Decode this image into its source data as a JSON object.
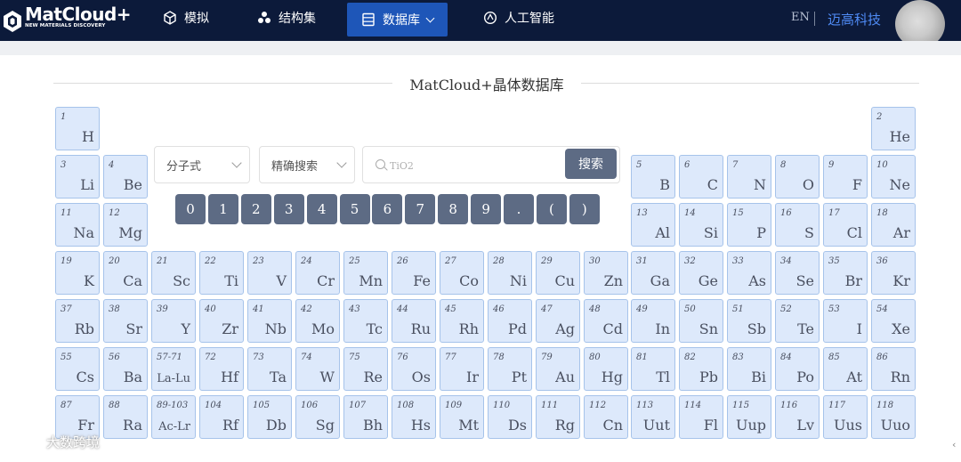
{
  "header": {
    "logo_title": "MatCloud+",
    "logo_subtitle": "NEW MATERIALS DISCOVERY",
    "nav": [
      {
        "label": "模拟",
        "icon": "cube-icon"
      },
      {
        "label": "结构集",
        "icon": "molecule-icon"
      },
      {
        "label": "数据库",
        "icon": "database-icon",
        "active": true
      },
      {
        "label": "人工智能",
        "icon": "ai-brain-icon"
      }
    ],
    "lang": "EN",
    "company": "迈高科技"
  },
  "page_title": "MatCloud+晶体数据库",
  "search": {
    "formula_select": "分子式",
    "mode_select": "精确搜索",
    "placeholder": "TiO2",
    "button": "搜索"
  },
  "keypad": [
    "0",
    "1",
    "2",
    "3",
    "4",
    "5",
    "6",
    "7",
    "8",
    "9",
    ".",
    "(",
    ")"
  ],
  "elements": [
    {
      "num": "1",
      "sym": "H"
    },
    {
      "num": "2",
      "sym": "He"
    },
    {
      "num": "3",
      "sym": "Li"
    },
    {
      "num": "4",
      "sym": "Be"
    },
    {
      "num": "5",
      "sym": "B"
    },
    {
      "num": "6",
      "sym": "C"
    },
    {
      "num": "7",
      "sym": "N"
    },
    {
      "num": "8",
      "sym": "O"
    },
    {
      "num": "9",
      "sym": "F"
    },
    {
      "num": "10",
      "sym": "Ne"
    },
    {
      "num": "11",
      "sym": "Na"
    },
    {
      "num": "12",
      "sym": "Mg"
    },
    {
      "num": "13",
      "sym": "Al"
    },
    {
      "num": "14",
      "sym": "Si"
    },
    {
      "num": "15",
      "sym": "P"
    },
    {
      "num": "16",
      "sym": "S"
    },
    {
      "num": "17",
      "sym": "Cl"
    },
    {
      "num": "18",
      "sym": "Ar"
    },
    {
      "num": "19",
      "sym": "K"
    },
    {
      "num": "20",
      "sym": "Ca"
    },
    {
      "num": "21",
      "sym": "Sc"
    },
    {
      "num": "22",
      "sym": "Ti"
    },
    {
      "num": "23",
      "sym": "V"
    },
    {
      "num": "24",
      "sym": "Cr"
    },
    {
      "num": "25",
      "sym": "Mn"
    },
    {
      "num": "26",
      "sym": "Fe"
    },
    {
      "num": "27",
      "sym": "Co"
    },
    {
      "num": "28",
      "sym": "Ni"
    },
    {
      "num": "29",
      "sym": "Cu"
    },
    {
      "num": "30",
      "sym": "Zn"
    },
    {
      "num": "31",
      "sym": "Ga"
    },
    {
      "num": "32",
      "sym": "Ge"
    },
    {
      "num": "33",
      "sym": "As"
    },
    {
      "num": "34",
      "sym": "Se"
    },
    {
      "num": "35",
      "sym": "Br"
    },
    {
      "num": "36",
      "sym": "Kr"
    },
    {
      "num": "37",
      "sym": "Rb"
    },
    {
      "num": "38",
      "sym": "Sr"
    },
    {
      "num": "39",
      "sym": "Y"
    },
    {
      "num": "40",
      "sym": "Zr"
    },
    {
      "num": "41",
      "sym": "Nb"
    },
    {
      "num": "42",
      "sym": "Mo"
    },
    {
      "num": "43",
      "sym": "Tc"
    },
    {
      "num": "44",
      "sym": "Ru"
    },
    {
      "num": "45",
      "sym": "Rh"
    },
    {
      "num": "46",
      "sym": "Pd"
    },
    {
      "num": "47",
      "sym": "Ag"
    },
    {
      "num": "48",
      "sym": "Cd"
    },
    {
      "num": "49",
      "sym": "In"
    },
    {
      "num": "50",
      "sym": "Sn"
    },
    {
      "num": "51",
      "sym": "Sb"
    },
    {
      "num": "52",
      "sym": "Te"
    },
    {
      "num": "53",
      "sym": "I"
    },
    {
      "num": "54",
      "sym": "Xe"
    },
    {
      "num": "55",
      "sym": "Cs"
    },
    {
      "num": "56",
      "sym": "Ba"
    },
    {
      "num": "57-71",
      "sym": "La-Lu"
    },
    {
      "num": "72",
      "sym": "Hf"
    },
    {
      "num": "73",
      "sym": "Ta"
    },
    {
      "num": "74",
      "sym": "W"
    },
    {
      "num": "75",
      "sym": "Re"
    },
    {
      "num": "76",
      "sym": "Os"
    },
    {
      "num": "77",
      "sym": "Ir"
    },
    {
      "num": "78",
      "sym": "Pt"
    },
    {
      "num": "79",
      "sym": "Au"
    },
    {
      "num": "80",
      "sym": "Hg"
    },
    {
      "num": "81",
      "sym": "Tl"
    },
    {
      "num": "82",
      "sym": "Pb"
    },
    {
      "num": "83",
      "sym": "Bi"
    },
    {
      "num": "84",
      "sym": "Po"
    },
    {
      "num": "85",
      "sym": "At"
    },
    {
      "num": "86",
      "sym": "Rn"
    },
    {
      "num": "87",
      "sym": "Fr"
    },
    {
      "num": "88",
      "sym": "Ra"
    },
    {
      "num": "89-103",
      "sym": "Ac-Lr"
    },
    {
      "num": "104",
      "sym": "Rf"
    },
    {
      "num": "105",
      "sym": "Db"
    },
    {
      "num": "106",
      "sym": "Sg"
    },
    {
      "num": "107",
      "sym": "Bh"
    },
    {
      "num": "108",
      "sym": "Hs"
    },
    {
      "num": "109",
      "sym": "Mt"
    },
    {
      "num": "110",
      "sym": "Ds"
    },
    {
      "num": "111",
      "sym": "Rg"
    },
    {
      "num": "112",
      "sym": "Cn"
    },
    {
      "num": "113",
      "sym": "Uut"
    },
    {
      "num": "114",
      "sym": "Fl"
    },
    {
      "num": "115",
      "sym": "Uup"
    },
    {
      "num": "116",
      "sym": "Lv"
    },
    {
      "num": "117",
      "sym": "Uus"
    },
    {
      "num": "118",
      "sym": "Uuo"
    }
  ],
  "watermark": "大数跨境",
  "colors": {
    "nav_bg": "#0c1a3a",
    "nav_active": "#1e56b8",
    "cell_bg": "#dde9fb",
    "cell_border": "#a6c3ea",
    "button_bg": "#5d6b84",
    "company": "#4f8bf5"
  }
}
